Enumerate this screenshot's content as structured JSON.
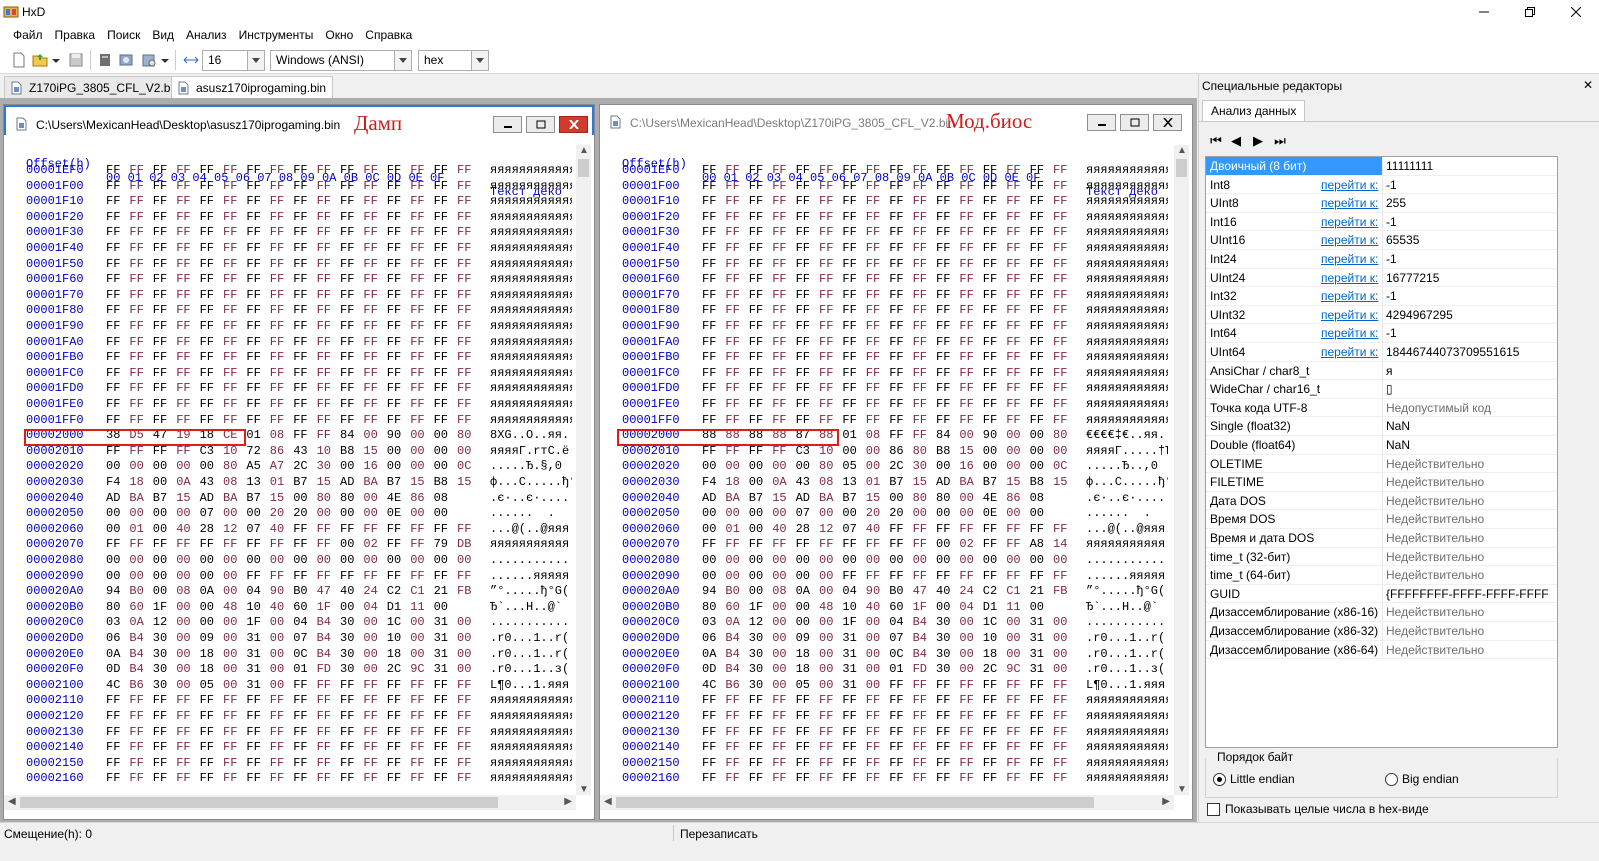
{
  "app": {
    "title": "HxD"
  },
  "menu": [
    "Файл",
    "Правка",
    "Поиск",
    "Вид",
    "Анализ",
    "Инструменты",
    "Окно",
    "Справка"
  ],
  "toolbar": {
    "bytes_per_row": "16",
    "charset": "Windows (ANSI)",
    "offset_base": "hex"
  },
  "tabs": [
    {
      "label": "Z170iPG_3805_CFL_V2.bin",
      "active": false
    },
    {
      "label": "asusz170iprogaming.bin",
      "active": true
    }
  ],
  "left_window": {
    "path": "C:\\Users\\MexicanHead\\Desktop\\asusz170iprogaming.bin",
    "annotation": "Дамп",
    "header_offset": "Offset(h)",
    "header_cols": "00 01 02 03 04 05 06 07 08 09 0A 0B 0C 0D 0E 0F",
    "header_text": "Текст деко",
    "rows": [
      {
        "o": "00001EF0",
        "b": "FF FF FF FF FF FF FF FF FF FF FF FF FF FF FF FF",
        "t": "яяяяяяяяяяяя"
      },
      {
        "o": "00001F00",
        "b": "FF FF FF FF FF FF FF FF FF FF FF FF FF FF FF FF",
        "t": "яяяяяяяяяяяя"
      },
      {
        "o": "00001F10",
        "b": "FF FF FF FF FF FF FF FF FF FF FF FF FF FF FF FF",
        "t": "яяяяяяяяяяяя"
      },
      {
        "o": "00001F20",
        "b": "FF FF FF FF FF FF FF FF FF FF FF FF FF FF FF FF",
        "t": "яяяяяяяяяяяя"
      },
      {
        "o": "00001F30",
        "b": "FF FF FF FF FF FF FF FF FF FF FF FF FF FF FF FF",
        "t": "яяяяяяяяяяяя"
      },
      {
        "o": "00001F40",
        "b": "FF FF FF FF FF FF FF FF FF FF FF FF FF FF FF FF",
        "t": "яяяяяяяяяяяя"
      },
      {
        "o": "00001F50",
        "b": "FF FF FF FF FF FF FF FF FF FF FF FF FF FF FF FF",
        "t": "яяяяяяяяяяяя"
      },
      {
        "o": "00001F60",
        "b": "FF FF FF FF FF FF FF FF FF FF FF FF FF FF FF FF",
        "t": "яяяяяяяяяяяя"
      },
      {
        "o": "00001F70",
        "b": "FF FF FF FF FF FF FF FF FF FF FF FF FF FF FF FF",
        "t": "яяяяяяяяяяяя"
      },
      {
        "o": "00001F80",
        "b": "FF FF FF FF FF FF FF FF FF FF FF FF FF FF FF FF",
        "t": "яяяяяяяяяяяя"
      },
      {
        "o": "00001F90",
        "b": "FF FF FF FF FF FF FF FF FF FF FF FF FF FF FF FF",
        "t": "яяяяяяяяяяяя"
      },
      {
        "o": "00001FA0",
        "b": "FF FF FF FF FF FF FF FF FF FF FF FF FF FF FF FF",
        "t": "яяяяяяяяяяяя"
      },
      {
        "o": "00001FB0",
        "b": "FF FF FF FF FF FF FF FF FF FF FF FF FF FF FF FF",
        "t": "яяяяяяяяяяяя"
      },
      {
        "o": "00001FC0",
        "b": "FF FF FF FF FF FF FF FF FF FF FF FF FF FF FF FF",
        "t": "яяяяяяяяяяяя"
      },
      {
        "o": "00001FD0",
        "b": "FF FF FF FF FF FF FF FF FF FF FF FF FF FF FF FF",
        "t": "яяяяяяяяяяяя"
      },
      {
        "o": "00001FE0",
        "b": "FF FF FF FF FF FF FF FF FF FF FF FF FF FF FF FF",
        "t": "яяяяяяяяяяяя"
      },
      {
        "o": "00001FF0",
        "b": "FF FF FF FF FF FF FF FF FF FF FF FF FF FF FF FF",
        "t": "яяяяяяяяяяяя"
      },
      {
        "o": "00002000",
        "b": "38 D5 47 19 18 CE 01 08 FF FF 84 00 90 00 00 80",
        "t": "8ХG..О..яя."
      },
      {
        "o": "00002010",
        "b": "FF FF FF FF C3 10 72 86 43 10 B8 15 00 00 00 00",
        "t": "яяяяГ.rтС.ё"
      },
      {
        "o": "00002020",
        "b": "00 00 00 00 00 80 A5 A7 2C 30 00 16 00 00 00 0C",
        "t": ".....Ђ.§,0"
      },
      {
        "o": "00002030",
        "b": "F4 18 00 0A 43 08 13 01 B7 15 AD BA B7 15 B8 15",
        "t": "ф...C.....ђ°GЕ"
      },
      {
        "o": "00002040",
        "b": "AD BA B7 15 AD BA B7 15 00 80 80 00 4E 86 08",
        "t": ".є·..є·...."
      },
      {
        "o": "00002050",
        "b": "00 00 00 00 07 00 00 20 20 00 00 00 0E 00 00",
        "t": "......  ."
      },
      {
        "o": "00002060",
        "b": "00 01 00 40 28 12 07 40 FF FF FF FF FF FF FF FF",
        "t": "...@(..@яяя"
      },
      {
        "o": "00002070",
        "b": "FF FF FF FF FF FF FF FF FF FF 00 02 FF FF 79 DB",
        "t": "яяяяяяяяяяя"
      },
      {
        "o": "00002080",
        "b": "00 00 00 00 00 00 00 00 00 00 00 00 00 00 00 00",
        "t": "..........."
      },
      {
        "o": "00002090",
        "b": "00 00 00 00 00 00 FF FF FF FF FF FF FF FF FF FF",
        "t": "......яяяяя"
      },
      {
        "o": "000020A0",
        "b": "94 B0 00 08 0A 00 04 90 B0 47 40 24 C2 C1 21 FB",
        "t": "”°.....ђ°G("
      },
      {
        "o": "000020B0",
        "b": "80 60 1F 00 00 48 10 40 60 1F 00 04 D1 11 00",
        "t": "Ђ`...H..@`"
      },
      {
        "o": "000020C0",
        "b": "03 0A 12 00 00 00 1F 00 04 B4 30 00 1C 00 31 00",
        "t": "............r("
      },
      {
        "o": "000020D0",
        "b": "06 B4 30 00 09 00 31 00 07 B4 30 00 10 00 31 00",
        "t": ".r0...1..r("
      },
      {
        "o": "000020E0",
        "b": "0A B4 30 00 18 00 31 00 0C B4 30 00 18 00 31 00",
        "t": ".r0...1..r("
      },
      {
        "o": "000020F0",
        "b": "0D B4 30 00 18 00 31 00 01 FD 30 00 2C 9C 31 00",
        "t": ".r0...1..з("
      },
      {
        "o": "00002100",
        "b": "4C B6 30 00 05 00 31 00 FF FF FF FF FF FF FF FF",
        "t": "L¶0...1.яяя"
      },
      {
        "o": "00002110",
        "b": "FF FF FF FF FF FF FF FF FF FF FF FF FF FF FF FF",
        "t": "яяяяяяяяяяяя"
      },
      {
        "o": "00002120",
        "b": "FF FF FF FF FF FF FF FF FF FF FF FF FF FF FF FF",
        "t": "яяяяяяяяяяяя"
      },
      {
        "o": "00002130",
        "b": "FF FF FF FF FF FF FF FF FF FF FF FF FF FF FF FF",
        "t": "яяяяяяяяяяяя"
      },
      {
        "o": "00002140",
        "b": "FF FF FF FF FF FF FF FF FF FF FF FF FF FF FF FF",
        "t": "яяяяяяяяяяяя"
      },
      {
        "o": "00002150",
        "b": "FF FF FF FF FF FF FF FF FF FF FF FF FF FF FF FF",
        "t": "яяяяяяяяяяяя"
      },
      {
        "o": "00002160",
        "b": "FF FF FF FF FF FF FF FF FF FF FF FF FF FF FF FF",
        "t": "яяяяяяяяяяяя"
      }
    ]
  },
  "right_window": {
    "path": "C:\\Users\\MexicanHead\\Desktop\\Z170iPG_3805_CFL_V2.bin",
    "annotation": "Мод.биос",
    "header_offset": "Offset(h)",
    "header_cols": "00 01 02 03 04 05 06 07 08 09 0A 0B 0C 0D 0E 0F",
    "header_text": "Текст деко",
    "rows": [
      {
        "o": "00001EF0",
        "b": "FF FF FF FF FF FF FF FF FF FF FF FF FF FF FF FF",
        "t": "яяяяяяяяяяяя"
      },
      {
        "o": "00001F00",
        "b": "FF FF FF FF FF FF FF FF FF FF FF FF FF FF FF FF",
        "t": "яяяяяяяяяяяя"
      },
      {
        "o": "00001F10",
        "b": "FF FF FF FF FF FF FF FF FF FF FF FF FF FF FF FF",
        "t": "яяяяяяяяяяяя"
      },
      {
        "o": "00001F20",
        "b": "FF FF FF FF FF FF FF FF FF FF FF FF FF FF FF FF",
        "t": "яяяяяяяяяяяя"
      },
      {
        "o": "00001F30",
        "b": "FF FF FF FF FF FF FF FF FF FF FF FF FF FF FF FF",
        "t": "яяяяяяяяяяяя"
      },
      {
        "o": "00001F40",
        "b": "FF FF FF FF FF FF FF FF FF FF FF FF FF FF FF FF",
        "t": "яяяяяяяяяяяя"
      },
      {
        "o": "00001F50",
        "b": "FF FF FF FF FF FF FF FF FF FF FF FF FF FF FF FF",
        "t": "яяяяяяяяяяяя"
      },
      {
        "o": "00001F60",
        "b": "FF FF FF FF FF FF FF FF FF FF FF FF FF FF FF FF",
        "t": "яяяяяяяяяяяя"
      },
      {
        "o": "00001F70",
        "b": "FF FF FF FF FF FF FF FF FF FF FF FF FF FF FF FF",
        "t": "яяяяяяяяяяяя"
      },
      {
        "o": "00001F80",
        "b": "FF FF FF FF FF FF FF FF FF FF FF FF FF FF FF FF",
        "t": "яяяяяяяяяяяя"
      },
      {
        "o": "00001F90",
        "b": "FF FF FF FF FF FF FF FF FF FF FF FF FF FF FF FF",
        "t": "яяяяяяяяяяяя"
      },
      {
        "o": "00001FA0",
        "b": "FF FF FF FF FF FF FF FF FF FF FF FF FF FF FF FF",
        "t": "яяяяяяяяяяяя"
      },
      {
        "o": "00001FB0",
        "b": "FF FF FF FF FF FF FF FF FF FF FF FF FF FF FF FF",
        "t": "яяяяяяяяяяяя"
      },
      {
        "o": "00001FC0",
        "b": "FF FF FF FF FF FF FF FF FF FF FF FF FF FF FF FF",
        "t": "яяяяяяяяяяяя"
      },
      {
        "o": "00001FD0",
        "b": "FF FF FF FF FF FF FF FF FF FF FF FF FF FF FF FF",
        "t": "яяяяяяяяяяяя"
      },
      {
        "o": "00001FE0",
        "b": "FF FF FF FF FF FF FF FF FF FF FF FF FF FF FF FF",
        "t": "яяяяяяяяяяяя"
      },
      {
        "o": "00001FF0",
        "b": "FF FF FF FF FF FF FF FF FF FF FF FF FF FF FF FF",
        "t": "яяяяяяяяяяяя"
      },
      {
        "o": "00002000",
        "b": "88 88 88 88 87 88 01 08 FF FF 84 00 90 00 00 80",
        "t": "€€€€‡€..яя."
      },
      {
        "o": "00002010",
        "b": "FF FF FF FF C3 10 00 00 86 80 B8 15 00 00 00 00",
        "t": "яяяяГ.....†Ђё"
      },
      {
        "o": "00002020",
        "b": "00 00 00 00 00 80 05 00 2C 30 00 16 00 00 00 0C",
        "t": ".....Ђ..,0"
      },
      {
        "o": "00002030",
        "b": "F4 18 00 0A 43 08 13 01 B7 15 AD BA B7 15 B8 15",
        "t": "ф...C.....ђ°GЕ"
      },
      {
        "o": "00002040",
        "b": "AD BA B7 15 AD BA B7 15 00 80 80 00 4E 86 08",
        "t": ".є·..є·...."
      },
      {
        "o": "00002050",
        "b": "00 00 00 00 07 00 00 20 20 00 00 00 0E 00 00",
        "t": "......  ."
      },
      {
        "o": "00002060",
        "b": "00 01 00 40 28 12 07 40 FF FF FF FF FF FF FF FF",
        "t": "...@(..@яяя"
      },
      {
        "o": "00002070",
        "b": "FF FF FF FF FF FF FF FF FF FF 00 02 FF FF A8 14",
        "t": "яяяяяяяяяяя"
      },
      {
        "o": "00002080",
        "b": "00 00 00 00 00 00 00 00 00 00 00 00 00 00 00 00",
        "t": "..........."
      },
      {
        "o": "00002090",
        "b": "00 00 00 00 00 00 FF FF FF FF FF FF FF FF FF FF",
        "t": "......яяяяя"
      },
      {
        "o": "000020A0",
        "b": "94 B0 00 08 0A 00 04 90 B0 47 40 24 C2 C1 21 FB",
        "t": "”°.....ђ°G("
      },
      {
        "o": "000020B0",
        "b": "80 60 1F 00 00 48 10 40 60 1F 00 04 D1 11 00",
        "t": "Ђ`...H..@`"
      },
      {
        "o": "000020C0",
        "b": "03 0A 12 00 00 00 1F 00 04 B4 30 00 1C 00 31 00",
        "t": "............r("
      },
      {
        "o": "000020D0",
        "b": "06 B4 30 00 09 00 31 00 07 B4 30 00 10 00 31 00",
        "t": ".r0...1..r("
      },
      {
        "o": "000020E0",
        "b": "0A B4 30 00 18 00 31 00 0C B4 30 00 18 00 31 00",
        "t": ".r0...1..r("
      },
      {
        "o": "000020F0",
        "b": "0D B4 30 00 18 00 31 00 01 FD 30 00 2C 9C 31 00",
        "t": ".r0...1..з("
      },
      {
        "o": "00002100",
        "b": "4C B6 30 00 05 00 31 00 FF FF FF FF FF FF FF FF",
        "t": "L¶0...1.яяя"
      },
      {
        "o": "00002110",
        "b": "FF FF FF FF FF FF FF FF FF FF FF FF FF FF FF FF",
        "t": "яяяяяяяяяяяя"
      },
      {
        "o": "00002120",
        "b": "FF FF FF FF FF FF FF FF FF FF FF FF FF FF FF FF",
        "t": "яяяяяяяяяяяя"
      },
      {
        "o": "00002130",
        "b": "FF FF FF FF FF FF FF FF FF FF FF FF FF FF FF FF",
        "t": "яяяяяяяяяяяя"
      },
      {
        "o": "00002140",
        "b": "FF FF FF FF FF FF FF FF FF FF FF FF FF FF FF FF",
        "t": "яяяяяяяяяяяя"
      },
      {
        "o": "00002150",
        "b": "FF FF FF FF FF FF FF FF FF FF FF FF FF FF FF FF",
        "t": "яяяяяяяяяяяя"
      },
      {
        "o": "00002160",
        "b": "FF FF FF FF FF FF FF FF FF FF FF FF FF FF FF FF",
        "t": "яяяяяяяяяяяя"
      }
    ]
  },
  "panel": {
    "title": "Специальные редакторы",
    "tab": "Анализ данных",
    "goto_label": "перейти к:",
    "inspector": [
      {
        "name": "Двоичный (8 бит)",
        "value": "11111111",
        "goto": false,
        "dim": false,
        "selected": true
      },
      {
        "name": "Int8",
        "value": "-1",
        "goto": true,
        "dim": false
      },
      {
        "name": "UInt8",
        "value": "255",
        "goto": true,
        "dim": false
      },
      {
        "name": "Int16",
        "value": "-1",
        "goto": true,
        "dim": false
      },
      {
        "name": "UInt16",
        "value": "65535",
        "goto": true,
        "dim": false
      },
      {
        "name": "Int24",
        "value": "-1",
        "goto": true,
        "dim": false
      },
      {
        "name": "UInt24",
        "value": "16777215",
        "goto": true,
        "dim": false
      },
      {
        "name": "Int32",
        "value": "-1",
        "goto": true,
        "dim": false
      },
      {
        "name": "UInt32",
        "value": "4294967295",
        "goto": true,
        "dim": false
      },
      {
        "name": "Int64",
        "value": "-1",
        "goto": true,
        "dim": false
      },
      {
        "name": "UInt64",
        "value": "18446744073709551615",
        "goto": true,
        "dim": false
      },
      {
        "name": "AnsiChar / char8_t",
        "value": "я",
        "goto": false,
        "dim": false
      },
      {
        "name": "WideChar / char16_t",
        "value": "▯",
        "goto": false,
        "dim": false
      },
      {
        "name": "Точка кода UTF-8",
        "value": "Недопустимый код",
        "goto": false,
        "dim": true
      },
      {
        "name": "Single (float32)",
        "value": "NaN",
        "goto": false,
        "dim": false
      },
      {
        "name": "Double (float64)",
        "value": "NaN",
        "goto": false,
        "dim": false
      },
      {
        "name": "OLETIME",
        "value": "Недействительно",
        "goto": false,
        "dim": true
      },
      {
        "name": "FILETIME",
        "value": "Недействительно",
        "goto": false,
        "dim": true
      },
      {
        "name": "Дата DOS",
        "value": "Недействительно",
        "goto": false,
        "dim": true
      },
      {
        "name": "Время DOS",
        "value": "Недействительно",
        "goto": false,
        "dim": true
      },
      {
        "name": "Время и дата DOS",
        "value": "Недействительно",
        "goto": false,
        "dim": true
      },
      {
        "name": "time_t (32-бит)",
        "value": "Недействительно",
        "goto": false,
        "dim": true
      },
      {
        "name": "time_t (64-бит)",
        "value": "Недействительно",
        "goto": false,
        "dim": true
      },
      {
        "name": "GUID",
        "value": "{FFFFFFFF-FFFF-FFFF-FFFF",
        "goto": false,
        "dim": false
      },
      {
        "name": "Дизассемблирование (x86-16)",
        "value": "Недействительно",
        "goto": false,
        "dim": true
      },
      {
        "name": "Дизассемблирование (x86-32)",
        "value": "Недействительно",
        "goto": false,
        "dim": true
      },
      {
        "name": "Дизассемблирование (x86-64)",
        "value": "Недействительно",
        "goto": false,
        "dim": true
      }
    ],
    "byte_order_title": "Порядок байт",
    "little_endian": "Little endian",
    "big_endian": "Big endian",
    "hex_checkbox": "Показывать целые числа в hex-виде"
  },
  "status": {
    "offset": "Смещение(h): 0",
    "mode": "Перезаписать"
  },
  "colors": {
    "offset": "#0000c8",
    "odd_col": "#7f2a42",
    "highlight": "#e01b1b",
    "selection": "#3399ff",
    "link": "#0066cc"
  }
}
